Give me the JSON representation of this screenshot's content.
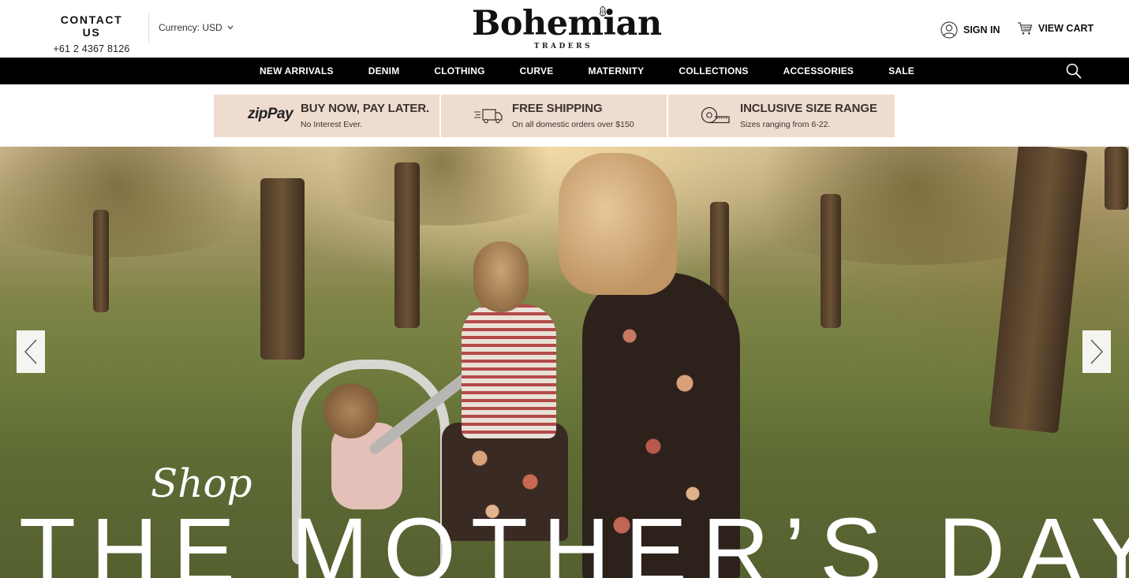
{
  "header": {
    "contact_title": "CONTACT US",
    "contact_phone": "+61 2 4367 8126",
    "currency_label": "Currency: USD",
    "logo_main": "Bohemian",
    "logo_sub": "TRADERS",
    "sign_in_label": "SIGN IN",
    "view_cart_label": "VIEW CART"
  },
  "nav": {
    "items": [
      "NEW ARRIVALS",
      "DENIM",
      "CLOTHING",
      "CURVE",
      "MATERNITY",
      "COLLECTIONS",
      "ACCESSORIES",
      "SALE"
    ]
  },
  "promo": [
    {
      "logo_text": "zipPay",
      "title": "BUY NOW, PAY LATER.",
      "subtitle": "No Interest Ever."
    },
    {
      "icon": "truck-icon",
      "title": "FREE SHIPPING",
      "subtitle": "On all domestic orders over $150"
    },
    {
      "icon": "measuring-tape-icon",
      "title": "INCLUSIVE SIZE RANGE",
      "subtitle": "Sizes ranging from 6-22."
    }
  ],
  "hero": {
    "shop_text": "Shop",
    "title": "THE MOTHER’S DAY EDIT"
  },
  "colors": {
    "nav_bg": "#000000",
    "promo_bg": "#efdcd0",
    "text_dark": "#111111"
  }
}
